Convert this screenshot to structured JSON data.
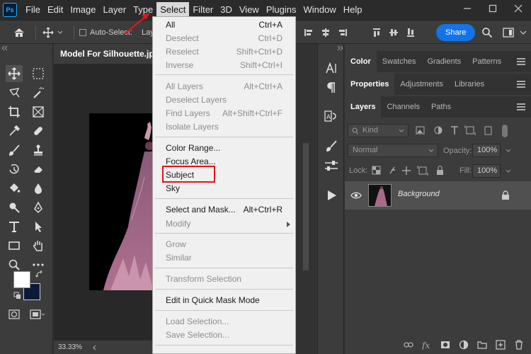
{
  "app": {
    "logo": "Ps"
  },
  "menubar": [
    "File",
    "Edit",
    "Image",
    "Layer",
    "Type",
    "Select",
    "Filter",
    "3D",
    "View",
    "Plugins",
    "Window",
    "Help"
  ],
  "options": {
    "auto_select": "Auto-Select:",
    "layer_dropdown": "Lay",
    "share": "Share"
  },
  "document": {
    "tab_title": "Model For  Silhouette.jpg",
    "zoom": "33.33%"
  },
  "select_menu": {
    "items": [
      {
        "label": "All",
        "shortcut": "Ctrl+A",
        "enabled": true
      },
      {
        "label": "Deselect",
        "shortcut": "Ctrl+D",
        "enabled": false
      },
      {
        "label": "Reselect",
        "shortcut": "Shift+Ctrl+D",
        "enabled": false
      },
      {
        "label": "Inverse",
        "shortcut": "Shift+Ctrl+I",
        "enabled": false
      },
      {
        "label": "All Layers",
        "shortcut": "Alt+Ctrl+A",
        "enabled": false
      },
      {
        "label": "Deselect Layers",
        "shortcut": "",
        "enabled": false
      },
      {
        "label": "Find Layers",
        "shortcut": "Alt+Shift+Ctrl+F",
        "enabled": false
      },
      {
        "label": "Isolate Layers",
        "shortcut": "",
        "enabled": false
      },
      {
        "label": "Color Range...",
        "shortcut": "",
        "enabled": true
      },
      {
        "label": "Focus Area...",
        "shortcut": "",
        "enabled": true
      },
      {
        "label": "Subject",
        "shortcut": "",
        "enabled": true
      },
      {
        "label": "Sky",
        "shortcut": "",
        "enabled": true
      },
      {
        "label": "Select and Mask...",
        "shortcut": "Alt+Ctrl+R",
        "enabled": true
      },
      {
        "label": "Modify",
        "shortcut": "",
        "enabled": false
      },
      {
        "label": "Grow",
        "shortcut": "",
        "enabled": false
      },
      {
        "label": "Similar",
        "shortcut": "",
        "enabled": false
      },
      {
        "label": "Transform Selection",
        "shortcut": "",
        "enabled": false
      },
      {
        "label": "Edit in Quick Mask Mode",
        "shortcut": "",
        "enabled": true
      },
      {
        "label": "Load Selection...",
        "shortcut": "",
        "enabled": false
      },
      {
        "label": "Save Selection...",
        "shortcut": "",
        "enabled": false
      }
    ]
  },
  "panels": {
    "tabs_row1": [
      "Color",
      "Swatches",
      "Gradients",
      "Patterns"
    ],
    "tabs_row2": [
      "Properties",
      "Adjustments",
      "Libraries"
    ],
    "tabs_row3": [
      "Layers",
      "Channels",
      "Paths"
    ],
    "layers": {
      "filter_kind": "Kind",
      "blend_mode": "Normal",
      "opacity_label": "Opacity:",
      "opacity_value": "100%",
      "lock_label": "Lock:",
      "fill_label": "Fill:",
      "fill_value": "100%",
      "layer_name": "Background"
    }
  },
  "colors": {
    "accent": "#1473e6",
    "highlight": "#e2131d",
    "menu_bg": "#f0f0f0",
    "panel_bg": "#3c3c3c",
    "foreground": "#ffffff",
    "background_swatch": "#0c1a3a"
  },
  "icons": {
    "toolbar": [
      "move-icon",
      "marquee-icon",
      "lasso-icon",
      "magic-wand-icon",
      "crop-icon",
      "frame-icon",
      "eyedropper-icon",
      "healing-icon",
      "brush-icon",
      "stamp-icon",
      "history-brush-icon",
      "eraser-icon",
      "bucket-icon",
      "blur-icon",
      "dodge-icon",
      "pen-icon",
      "type-icon",
      "path-select-icon",
      "rectangle-icon",
      "hand-icon",
      "zoom-icon",
      "more-icon"
    ]
  }
}
